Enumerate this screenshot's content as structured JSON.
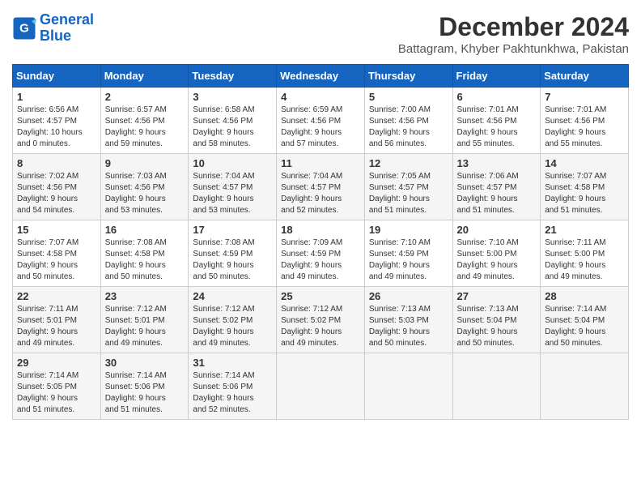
{
  "header": {
    "logo_line1": "General",
    "logo_line2": "Blue",
    "month": "December 2024",
    "location": "Battagram, Khyber Pakhtunkhwa, Pakistan"
  },
  "weekdays": [
    "Sunday",
    "Monday",
    "Tuesday",
    "Wednesday",
    "Thursday",
    "Friday",
    "Saturday"
  ],
  "weeks": [
    [
      {
        "day": "1",
        "sunrise": "Sunrise: 6:56 AM",
        "sunset": "Sunset: 4:57 PM",
        "daylight": "Daylight: 10 hours and 0 minutes."
      },
      {
        "day": "2",
        "sunrise": "Sunrise: 6:57 AM",
        "sunset": "Sunset: 4:56 PM",
        "daylight": "Daylight: 9 hours and 59 minutes."
      },
      {
        "day": "3",
        "sunrise": "Sunrise: 6:58 AM",
        "sunset": "Sunset: 4:56 PM",
        "daylight": "Daylight: 9 hours and 58 minutes."
      },
      {
        "day": "4",
        "sunrise": "Sunrise: 6:59 AM",
        "sunset": "Sunset: 4:56 PM",
        "daylight": "Daylight: 9 hours and 57 minutes."
      },
      {
        "day": "5",
        "sunrise": "Sunrise: 7:00 AM",
        "sunset": "Sunset: 4:56 PM",
        "daylight": "Daylight: 9 hours and 56 minutes."
      },
      {
        "day": "6",
        "sunrise": "Sunrise: 7:01 AM",
        "sunset": "Sunset: 4:56 PM",
        "daylight": "Daylight: 9 hours and 55 minutes."
      },
      {
        "day": "7",
        "sunrise": "Sunrise: 7:01 AM",
        "sunset": "Sunset: 4:56 PM",
        "daylight": "Daylight: 9 hours and 55 minutes."
      }
    ],
    [
      {
        "day": "8",
        "sunrise": "Sunrise: 7:02 AM",
        "sunset": "Sunset: 4:56 PM",
        "daylight": "Daylight: 9 hours and 54 minutes."
      },
      {
        "day": "9",
        "sunrise": "Sunrise: 7:03 AM",
        "sunset": "Sunset: 4:56 PM",
        "daylight": "Daylight: 9 hours and 53 minutes."
      },
      {
        "day": "10",
        "sunrise": "Sunrise: 7:04 AM",
        "sunset": "Sunset: 4:57 PM",
        "daylight": "Daylight: 9 hours and 53 minutes."
      },
      {
        "day": "11",
        "sunrise": "Sunrise: 7:04 AM",
        "sunset": "Sunset: 4:57 PM",
        "daylight": "Daylight: 9 hours and 52 minutes."
      },
      {
        "day": "12",
        "sunrise": "Sunrise: 7:05 AM",
        "sunset": "Sunset: 4:57 PM",
        "daylight": "Daylight: 9 hours and 51 minutes."
      },
      {
        "day": "13",
        "sunrise": "Sunrise: 7:06 AM",
        "sunset": "Sunset: 4:57 PM",
        "daylight": "Daylight: 9 hours and 51 minutes."
      },
      {
        "day": "14",
        "sunrise": "Sunrise: 7:07 AM",
        "sunset": "Sunset: 4:58 PM",
        "daylight": "Daylight: 9 hours and 51 minutes."
      }
    ],
    [
      {
        "day": "15",
        "sunrise": "Sunrise: 7:07 AM",
        "sunset": "Sunset: 4:58 PM",
        "daylight": "Daylight: 9 hours and 50 minutes."
      },
      {
        "day": "16",
        "sunrise": "Sunrise: 7:08 AM",
        "sunset": "Sunset: 4:58 PM",
        "daylight": "Daylight: 9 hours and 50 minutes."
      },
      {
        "day": "17",
        "sunrise": "Sunrise: 7:08 AM",
        "sunset": "Sunset: 4:59 PM",
        "daylight": "Daylight: 9 hours and 50 minutes."
      },
      {
        "day": "18",
        "sunrise": "Sunrise: 7:09 AM",
        "sunset": "Sunset: 4:59 PM",
        "daylight": "Daylight: 9 hours and 49 minutes."
      },
      {
        "day": "19",
        "sunrise": "Sunrise: 7:10 AM",
        "sunset": "Sunset: 4:59 PM",
        "daylight": "Daylight: 9 hours and 49 minutes."
      },
      {
        "day": "20",
        "sunrise": "Sunrise: 7:10 AM",
        "sunset": "Sunset: 5:00 PM",
        "daylight": "Daylight: 9 hours and 49 minutes."
      },
      {
        "day": "21",
        "sunrise": "Sunrise: 7:11 AM",
        "sunset": "Sunset: 5:00 PM",
        "daylight": "Daylight: 9 hours and 49 minutes."
      }
    ],
    [
      {
        "day": "22",
        "sunrise": "Sunrise: 7:11 AM",
        "sunset": "Sunset: 5:01 PM",
        "daylight": "Daylight: 9 hours and 49 minutes."
      },
      {
        "day": "23",
        "sunrise": "Sunrise: 7:12 AM",
        "sunset": "Sunset: 5:01 PM",
        "daylight": "Daylight: 9 hours and 49 minutes."
      },
      {
        "day": "24",
        "sunrise": "Sunrise: 7:12 AM",
        "sunset": "Sunset: 5:02 PM",
        "daylight": "Daylight: 9 hours and 49 minutes."
      },
      {
        "day": "25",
        "sunrise": "Sunrise: 7:12 AM",
        "sunset": "Sunset: 5:02 PM",
        "daylight": "Daylight: 9 hours and 49 minutes."
      },
      {
        "day": "26",
        "sunrise": "Sunrise: 7:13 AM",
        "sunset": "Sunset: 5:03 PM",
        "daylight": "Daylight: 9 hours and 50 minutes."
      },
      {
        "day": "27",
        "sunrise": "Sunrise: 7:13 AM",
        "sunset": "Sunset: 5:04 PM",
        "daylight": "Daylight: 9 hours and 50 minutes."
      },
      {
        "day": "28",
        "sunrise": "Sunrise: 7:14 AM",
        "sunset": "Sunset: 5:04 PM",
        "daylight": "Daylight: 9 hours and 50 minutes."
      }
    ],
    [
      {
        "day": "29",
        "sunrise": "Sunrise: 7:14 AM",
        "sunset": "Sunset: 5:05 PM",
        "daylight": "Daylight: 9 hours and 51 minutes."
      },
      {
        "day": "30",
        "sunrise": "Sunrise: 7:14 AM",
        "sunset": "Sunset: 5:06 PM",
        "daylight": "Daylight: 9 hours and 51 minutes."
      },
      {
        "day": "31",
        "sunrise": "Sunrise: 7:14 AM",
        "sunset": "Sunset: 5:06 PM",
        "daylight": "Daylight: 9 hours and 52 minutes."
      },
      null,
      null,
      null,
      null
    ]
  ]
}
